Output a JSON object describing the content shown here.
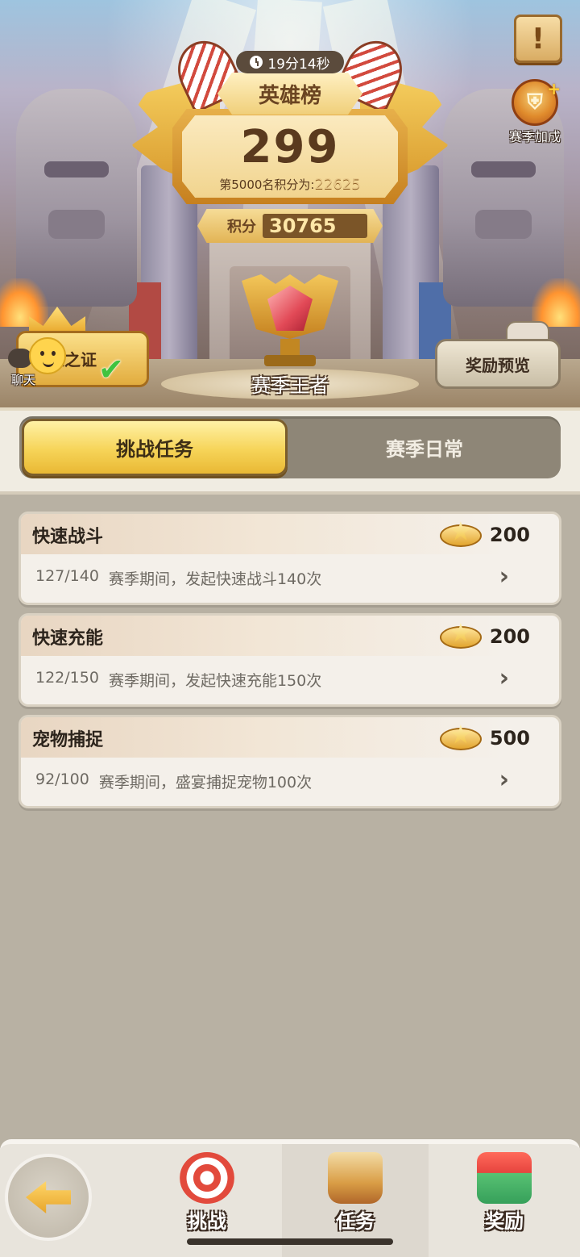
{
  "hero": {
    "timer": "19分14秒",
    "board_title": "英雄榜",
    "rank": "299",
    "threshold_prefix": "第5000名积分为:",
    "threshold_value": "22625",
    "score_label": "积分",
    "score_value": "30765",
    "trophy_label": "赛季王者",
    "season_bonus_label": "赛季加成",
    "cert_label": "雄之证",
    "chat_label": "聊天",
    "reward_preview_label": "奖励预览",
    "info_icon": "!"
  },
  "tabs": [
    {
      "label": "挑战任务",
      "active": true
    },
    {
      "label": "赛季日常",
      "active": false
    }
  ],
  "tasks": [
    {
      "title": "快速战斗",
      "reward": "200",
      "progress": "127/140",
      "description": "赛季期间，发起快速战斗140次"
    },
    {
      "title": "快速充能",
      "reward": "200",
      "progress": "122/150",
      "description": "赛季期间，发起快速充能150次"
    },
    {
      "title": "宠物捕捉",
      "reward": "500",
      "progress": "92/100",
      "description": "赛季期间，盛宴捕捉宠物100次"
    }
  ],
  "nav": {
    "items": [
      {
        "label": "挑战",
        "icon": "target-icon"
      },
      {
        "label": "任务",
        "icon": "quest-scroll-icon",
        "active": true
      },
      {
        "label": "奖励",
        "icon": "gift-icon"
      }
    ]
  },
  "colors": {
    "accent_gold": "#f6d458",
    "background": "#b8b1a3",
    "card": "#f4f0ea"
  }
}
